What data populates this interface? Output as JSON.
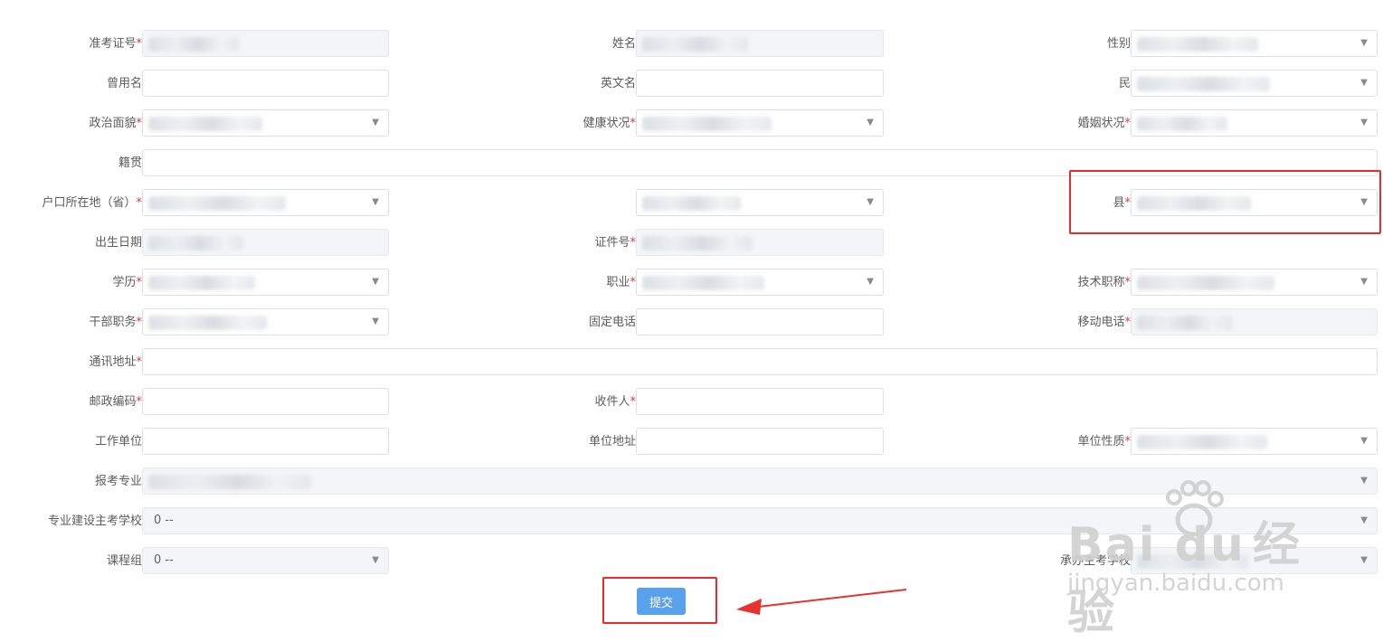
{
  "form": {
    "rows": [
      [
        {
          "label": "准考证号",
          "req": true,
          "ro": true,
          "sel": false,
          "full": false
        },
        {
          "label": "姓名",
          "req": false,
          "ro": true,
          "sel": false,
          "full": false
        },
        {
          "label": "性别",
          "req": false,
          "ro": false,
          "sel": true,
          "full": false
        }
      ],
      [
        {
          "label": "曾用名",
          "req": false,
          "ro": false,
          "sel": false,
          "full": false
        },
        {
          "label": "英文名",
          "req": false,
          "ro": false,
          "sel": false,
          "full": false
        },
        {
          "label": "民",
          "req": false,
          "ro": false,
          "sel": true,
          "full": false
        }
      ],
      [
        {
          "label": "政治面貌",
          "req": true,
          "ro": false,
          "sel": true,
          "full": false
        },
        {
          "label": "健康状况",
          "req": true,
          "ro": false,
          "sel": true,
          "full": false
        },
        {
          "label": "婚姻状况",
          "req": true,
          "ro": false,
          "sel": true,
          "full": false
        }
      ],
      [
        {
          "label": "籍贯",
          "req": false,
          "ro": false,
          "sel": false,
          "full": true
        }
      ],
      [
        {
          "label": "户口所在地（省）",
          "req": true,
          "ro": false,
          "sel": true,
          "full": false
        },
        {
          "label": "",
          "req": false,
          "ro": false,
          "sel": true,
          "full": false
        },
        {
          "label": "县",
          "req": true,
          "ro": false,
          "sel": true,
          "full": false
        }
      ],
      [
        {
          "label": "出生日期",
          "req": false,
          "ro": true,
          "sel": false,
          "full": false
        },
        {
          "label": "证件号",
          "req": true,
          "ro": true,
          "sel": false,
          "full": false
        }
      ],
      [
        {
          "label": "学历",
          "req": true,
          "ro": false,
          "sel": true,
          "full": false
        },
        {
          "label": "职业",
          "req": true,
          "ro": false,
          "sel": true,
          "full": false
        },
        {
          "label": "技术职称",
          "req": true,
          "ro": false,
          "sel": true,
          "full": false
        }
      ],
      [
        {
          "label": "干部职务",
          "req": true,
          "ro": false,
          "sel": true,
          "full": false
        },
        {
          "label": "固定电话",
          "req": false,
          "ro": false,
          "sel": false,
          "full": false
        },
        {
          "label": "移动电话",
          "req": true,
          "ro": true,
          "sel": false,
          "full": false
        }
      ],
      [
        {
          "label": "通讯地址",
          "req": true,
          "ro": false,
          "sel": false,
          "full": true
        }
      ],
      [
        {
          "label": "邮政编码",
          "req": true,
          "ro": false,
          "sel": false,
          "full": false
        },
        {
          "label": "收件人",
          "req": true,
          "ro": false,
          "sel": false,
          "full": false
        }
      ],
      [
        {
          "label": "工作单位",
          "req": false,
          "ro": false,
          "sel": false,
          "full": false
        },
        {
          "label": "单位地址",
          "req": false,
          "ro": false,
          "sel": false,
          "full": false
        },
        {
          "label": "单位性质",
          "req": true,
          "ro": false,
          "sel": true,
          "full": false
        }
      ],
      [
        {
          "label": "报考专业",
          "req": false,
          "ro": true,
          "sel": true,
          "full": true
        }
      ],
      [
        {
          "label": "专业建设主考学校",
          "req": false,
          "ro": true,
          "sel": true,
          "full": true,
          "value": "0 --"
        }
      ],
      [
        {
          "label": "课程组",
          "req": false,
          "ro": true,
          "sel": true,
          "full": false,
          "value": "0 --"
        },
        {
          "label": "",
          "skip": true
        },
        {
          "label": "承办主考学校",
          "req": false,
          "ro": true,
          "sel": true,
          "full": false
        }
      ]
    ]
  },
  "submit_label": "提交",
  "watermark": {
    "brand": "Bai du",
    "product": "经验",
    "site": "jingyan.baidu.com"
  }
}
